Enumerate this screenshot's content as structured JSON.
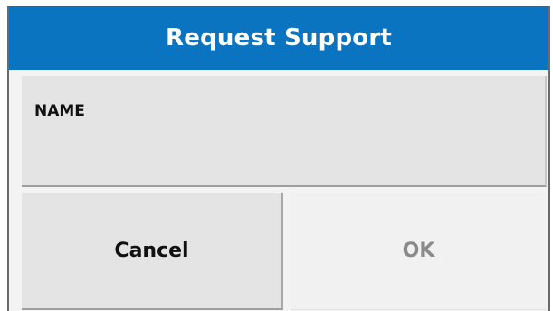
{
  "dialog": {
    "title": "Request Support",
    "name_field": {
      "label": "NAME",
      "value": ""
    },
    "buttons": {
      "cancel_label": "Cancel",
      "ok_label": "OK",
      "ok_enabled": false
    }
  },
  "colors": {
    "title_bar": "#0a74c0",
    "title_text": "#ffffff",
    "button_bg": "#e4e4e4",
    "disabled_button_bg": "#f1f1f1",
    "disabled_text": "#8a8a8a"
  }
}
